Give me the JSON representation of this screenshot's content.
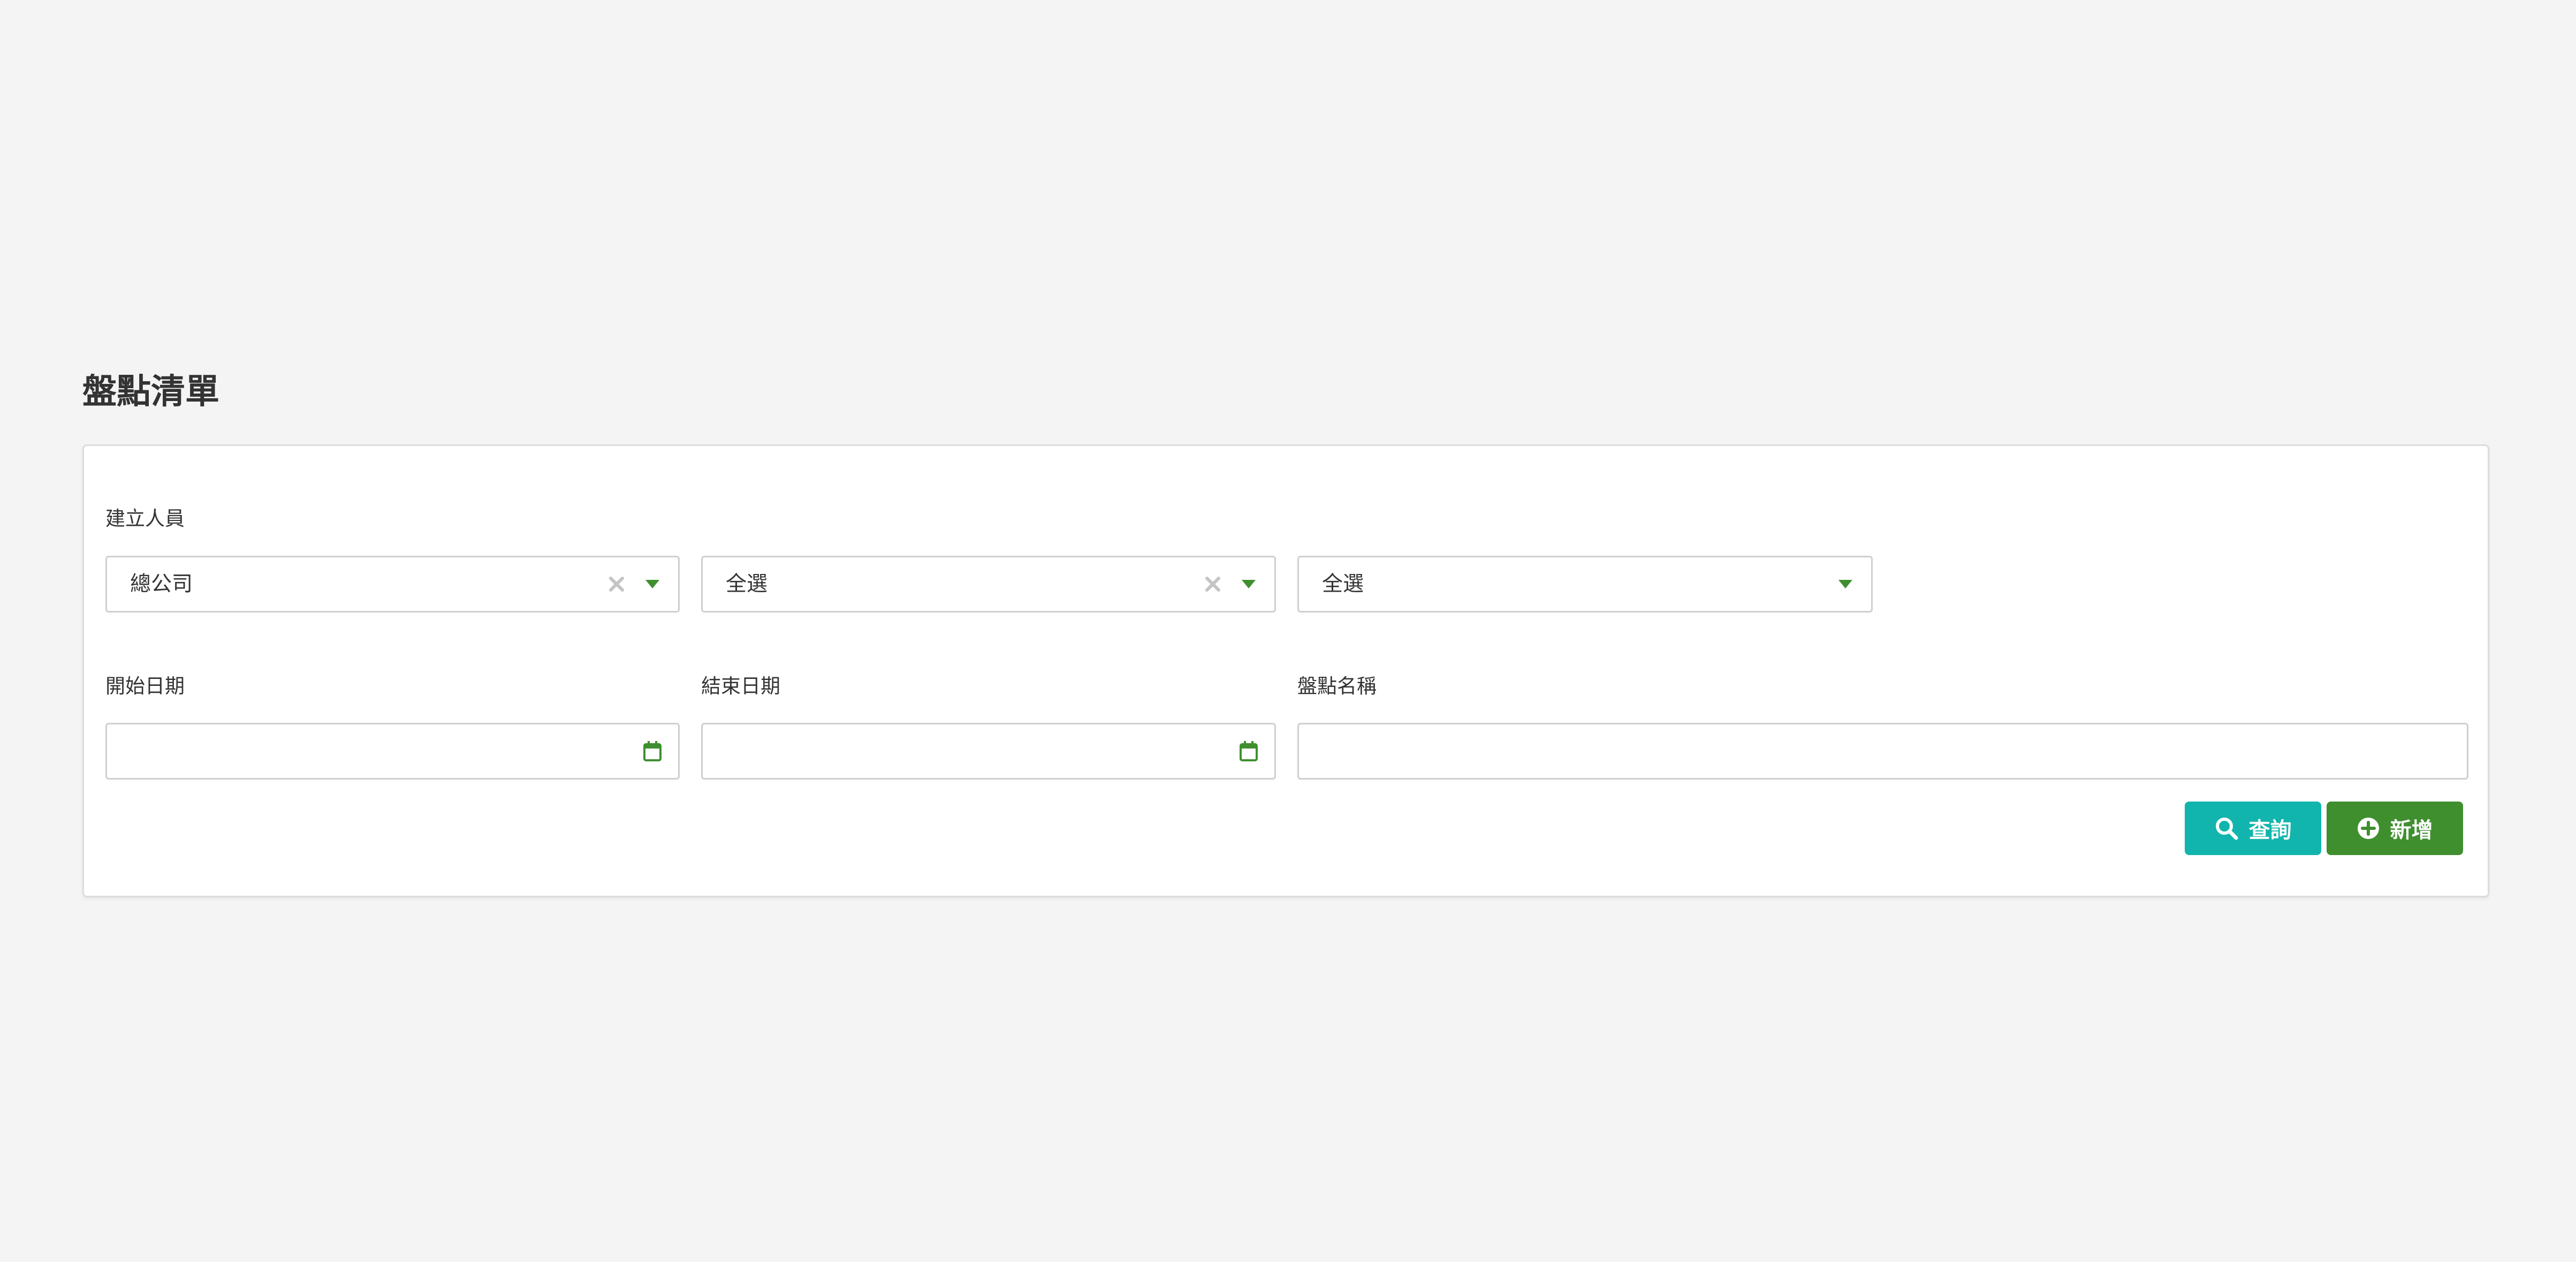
{
  "page": {
    "title": "盤點清單"
  },
  "filters": {
    "creator_label": "建立人員",
    "creator_selects": [
      {
        "value": "總公司",
        "clearable": true
      },
      {
        "value": "全選",
        "clearable": true
      },
      {
        "value": "全選",
        "clearable": false
      }
    ],
    "start_date_label": "開始日期",
    "start_date_value": "",
    "end_date_label": "結束日期",
    "end_date_value": "",
    "stocktake_name_label": "盤點名稱",
    "stocktake_name_value": ""
  },
  "actions": {
    "search_label": "查詢",
    "add_label": "新增"
  },
  "icons": {
    "clear": "close-icon",
    "dropdown": "caret-down-icon",
    "calendar": "calendar-icon",
    "search": "search-icon",
    "add": "plus-circle-icon"
  },
  "colors": {
    "background": "#f4f4f4",
    "accent_green": "#3f8f2f",
    "search_button": "#11b5ad",
    "add_button": "#3f8f2f",
    "clear_icon": "#c4c4c4"
  }
}
